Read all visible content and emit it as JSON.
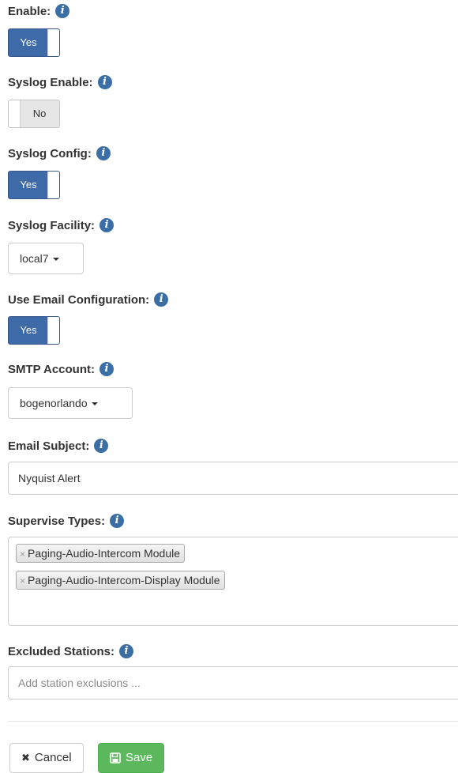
{
  "fields": {
    "enable": {
      "label": "Enable:",
      "value": "Yes"
    },
    "syslog_enable": {
      "label": "Syslog Enable:",
      "value": "No"
    },
    "syslog_config": {
      "label": "Syslog Config:",
      "value": "Yes"
    },
    "syslog_facility": {
      "label": "Syslog Facility:",
      "value": "local7"
    },
    "use_email_config": {
      "label": "Use Email Configuration:",
      "value": "Yes"
    },
    "smtp_account": {
      "label": "SMTP Account:",
      "value": "bogenorlando"
    },
    "email_subject": {
      "label": "Email Subject:",
      "value": "Nyquist Alert"
    },
    "supervise_types": {
      "label": "Supervise Types:",
      "tags": [
        "Paging-Audio-Intercom Module",
        "Paging-Audio-Intercom-Display Module"
      ]
    },
    "excluded_stations": {
      "label": "Excluded Stations:",
      "placeholder": "Add station exclusions ..."
    }
  },
  "buttons": {
    "cancel": "Cancel",
    "save": "Save"
  },
  "icons": {
    "info": "info-icon",
    "remove_tag": "×",
    "cancel": "✖"
  },
  "colors": {
    "toggle_on": "#3e6aa8",
    "info_icon": "#3a6ea5",
    "save_button": "#5cb85c"
  }
}
